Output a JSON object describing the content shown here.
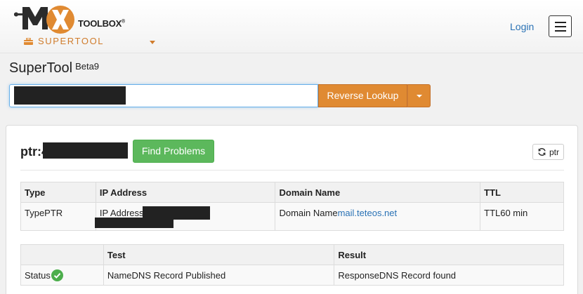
{
  "header": {
    "logo": {
      "brand_mark": "MX",
      "wordmark": "TOOLBOX",
      "registered": "®",
      "product": "SUPERTOOL"
    },
    "login_label": "Login",
    "menu_icon": "hamburger-icon"
  },
  "page": {
    "title": "SuperTool",
    "badge": "Beta9"
  },
  "search": {
    "value": "",
    "lookup_label": "Reverse Lookup"
  },
  "result": {
    "title_prefix": "ptr:4",
    "find_label": "Find Problems",
    "refresh_label": "ptr",
    "ptr_table": {
      "headers": [
        "Type",
        "IP Address",
        "Domain Name",
        "TTL"
      ],
      "row": {
        "type": "TypePTR",
        "ip_prefix": "IP Address",
        "domain_prefix": "Domain Name",
        "domain_link": "mail.teteos.net",
        "ttl": "TTL60 min"
      }
    },
    "test_table": {
      "headers": [
        "",
        "Test",
        "Result"
      ],
      "row": {
        "status": "Status",
        "test": "NameDNS Record Published",
        "result": "ResponseDNS Record found"
      }
    }
  },
  "colors": {
    "accent_orange": "#e08a32",
    "success_green": "#5cb85c",
    "link_blue": "#2a72b5"
  }
}
